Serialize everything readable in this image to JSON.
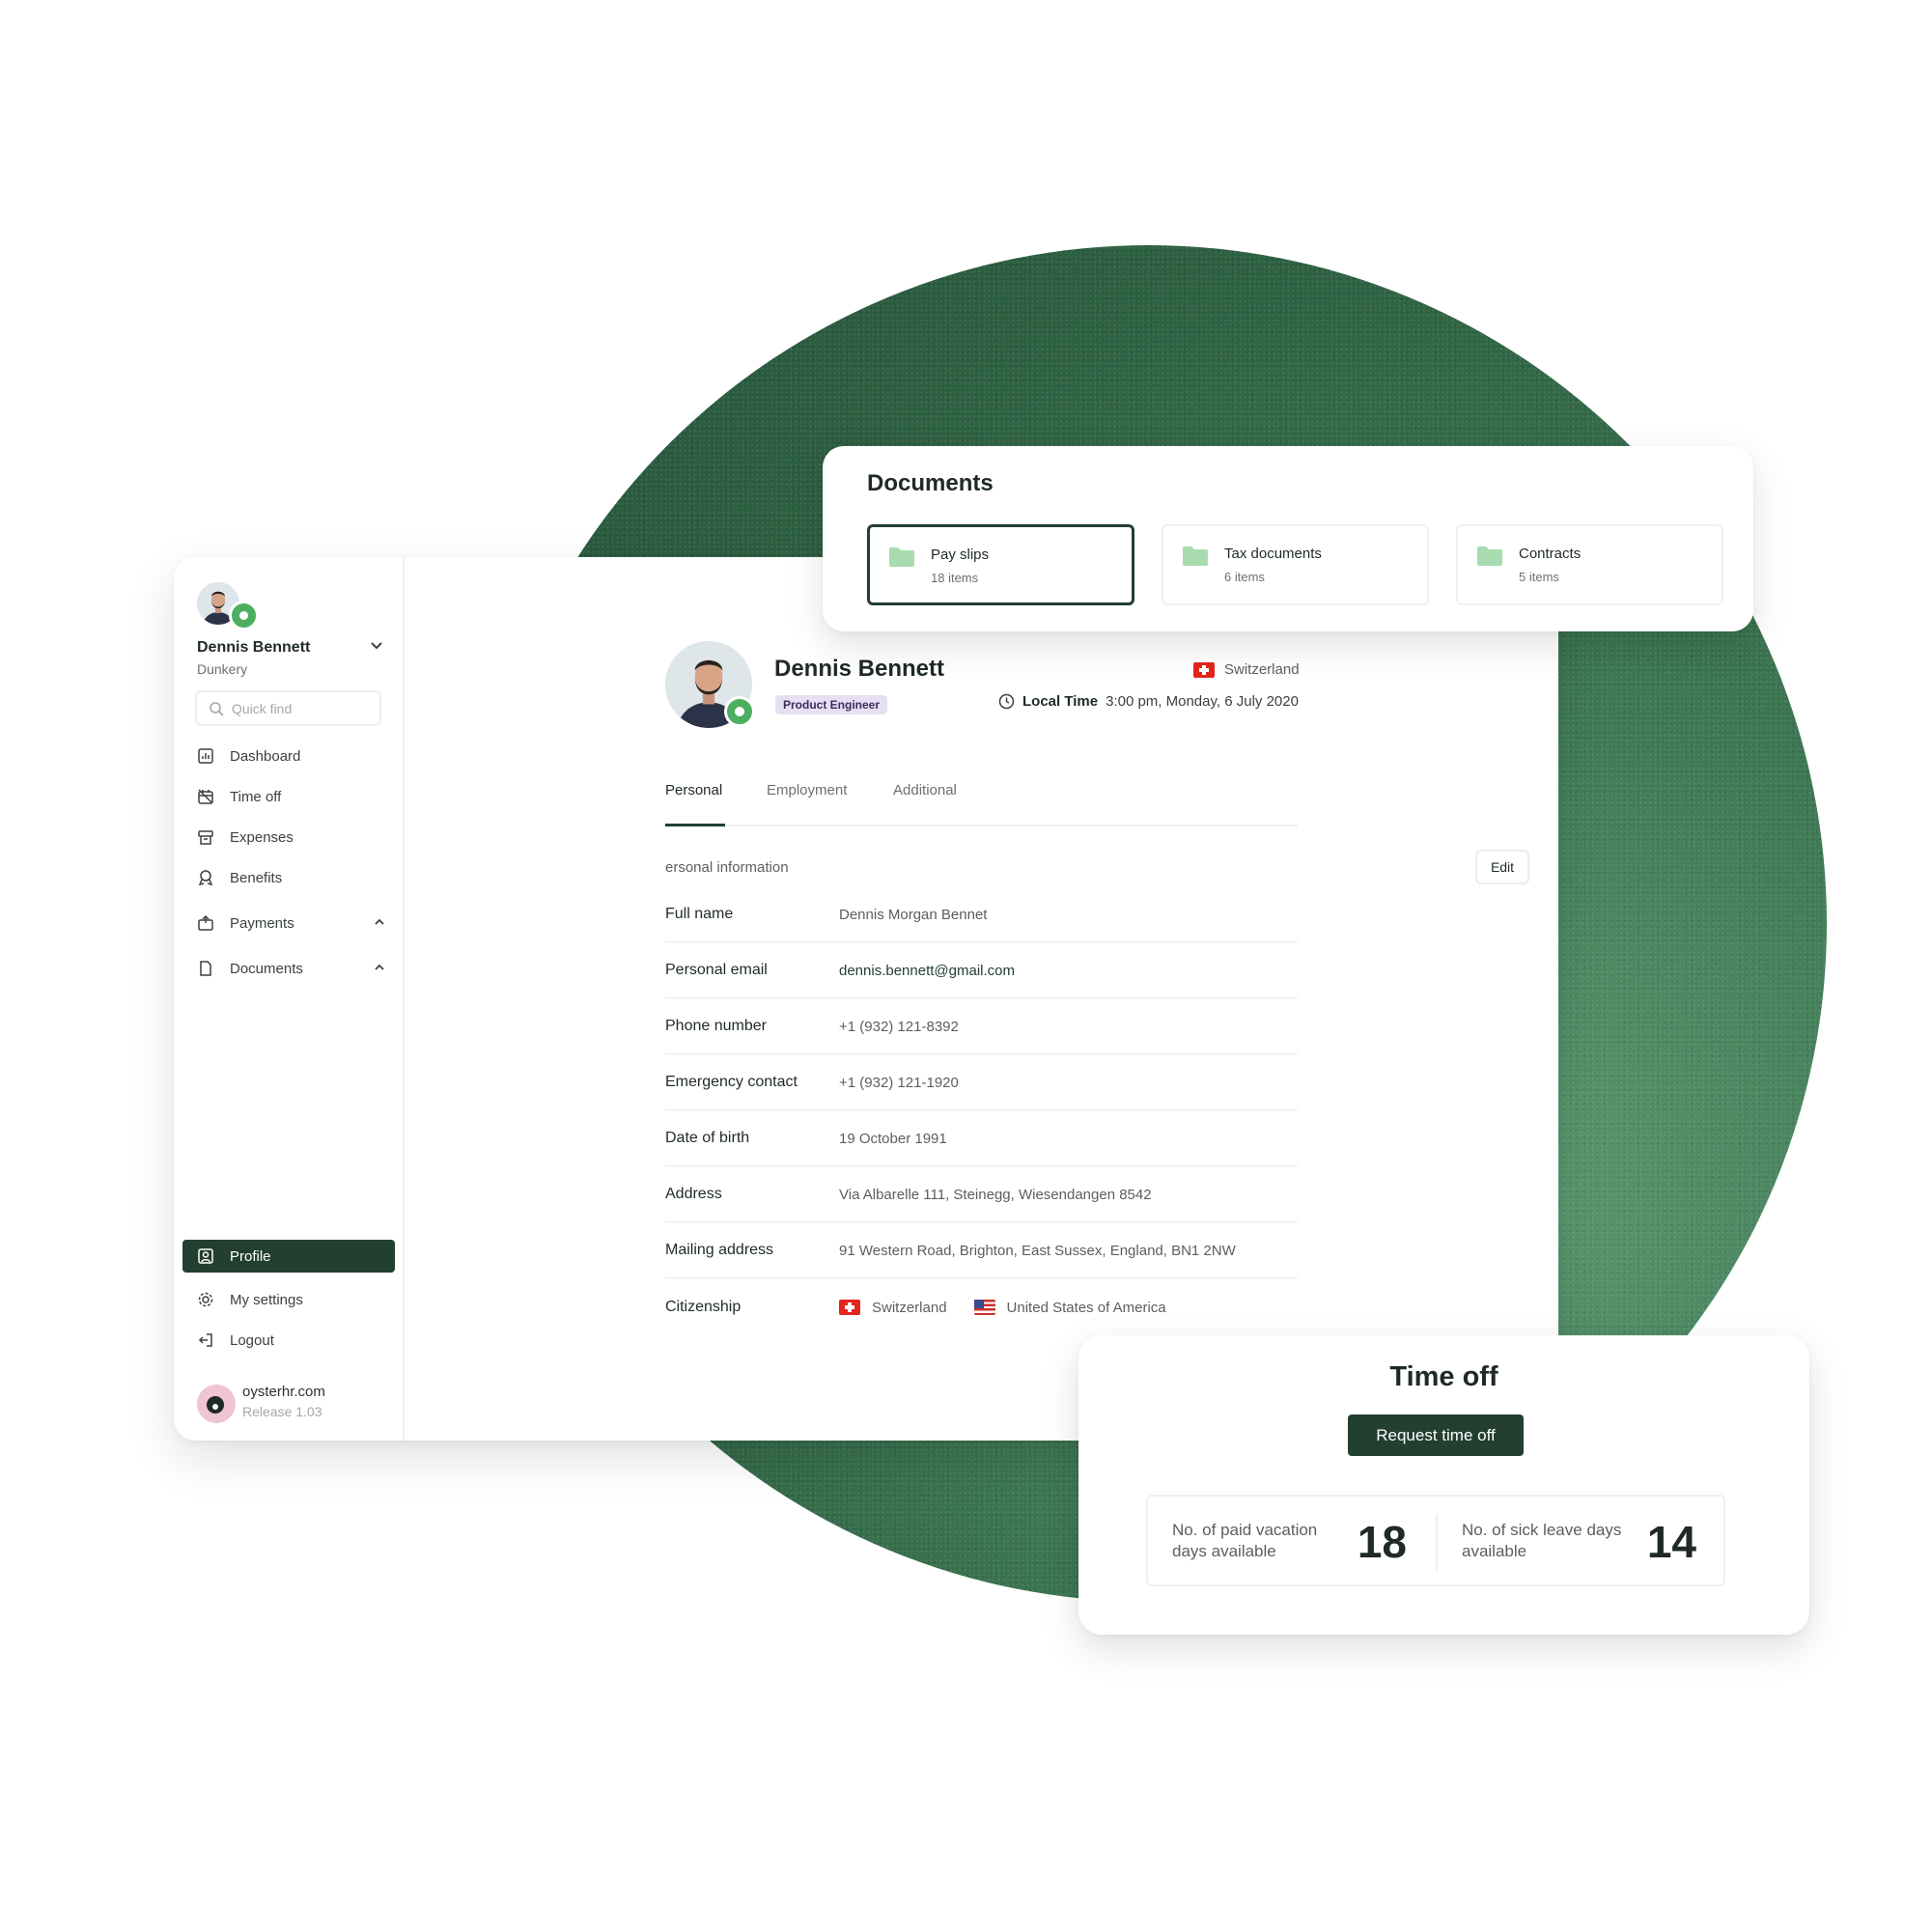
{
  "sidebar": {
    "user_name": "Dennis Bennett",
    "company": "Dunkery",
    "search_placeholder": "Quick find",
    "nav": [
      {
        "label": "Dashboard",
        "icon": "chart-icon"
      },
      {
        "label": "Time off",
        "icon": "calendar-off-icon"
      },
      {
        "label": "Expenses",
        "icon": "receipt-icon"
      },
      {
        "label": "Benefits",
        "icon": "ribbon-icon"
      },
      {
        "label": "Payments",
        "icon": "wallet-icon"
      },
      {
        "label": "Documents",
        "icon": "document-icon"
      }
    ],
    "bottom_nav": [
      {
        "label": "Profile",
        "icon": "user-square-icon",
        "active": true
      },
      {
        "label": "My settings",
        "icon": "gear-icon"
      },
      {
        "label": "Logout",
        "icon": "logout-icon"
      }
    ],
    "footer": {
      "site": "oysterhr.com",
      "release": "Release 1.03"
    }
  },
  "profile": {
    "name": "Dennis Bennett",
    "role": "Product Engineer",
    "country": "Switzerland",
    "local_time_label": "Local Time",
    "local_time_value": "3:00 pm, Monday, 6 July 2020"
  },
  "tabs": [
    {
      "label": "Personal",
      "active": true
    },
    {
      "label": "Employment"
    },
    {
      "label": "Additional"
    }
  ],
  "personal": {
    "section_title": "ersonal information",
    "edit_label": "Edit",
    "fields": [
      {
        "label": "Full name",
        "value": "Dennis Morgan Bennet"
      },
      {
        "label": "Personal email",
        "value": "dennis.bennett@gmail.com"
      },
      {
        "label": "Phone number",
        "value": "+1 (932) 121-8392"
      },
      {
        "label": "Emergency contact",
        "value": "+1 (932) 121-1920"
      },
      {
        "label": "Date of birth",
        "value": "19 October 1991"
      },
      {
        "label": "Address",
        "value": "Via Albarelle 111, Steinegg, Wiesendangen 8542"
      },
      {
        "label": "Mailing address",
        "value": "91 Western Road, Brighton, East Sussex, England, BN1 2NW"
      },
      {
        "label": "Citizenship",
        "values": [
          "Switzerland",
          "United States of America"
        ]
      }
    ]
  },
  "documents": {
    "title": "Documents",
    "folders": [
      {
        "name": "Pay slips",
        "count": "18 items",
        "selected": true
      },
      {
        "name": "Tax documents",
        "count": "6 items"
      },
      {
        "name": "Contracts",
        "count": "5 items"
      }
    ]
  },
  "time_off": {
    "title": "Time off",
    "request_label": "Request time off",
    "stats": [
      {
        "label": "No. of paid vacation days available",
        "value": "18"
      },
      {
        "label": "No. of sick leave days available",
        "value": "14"
      }
    ]
  },
  "colors": {
    "brand_dark_green": "#233f31",
    "status_green": "#4caf5f",
    "role_badge_bg": "#e7e0f3",
    "folder_green": "#a8dcb0"
  }
}
